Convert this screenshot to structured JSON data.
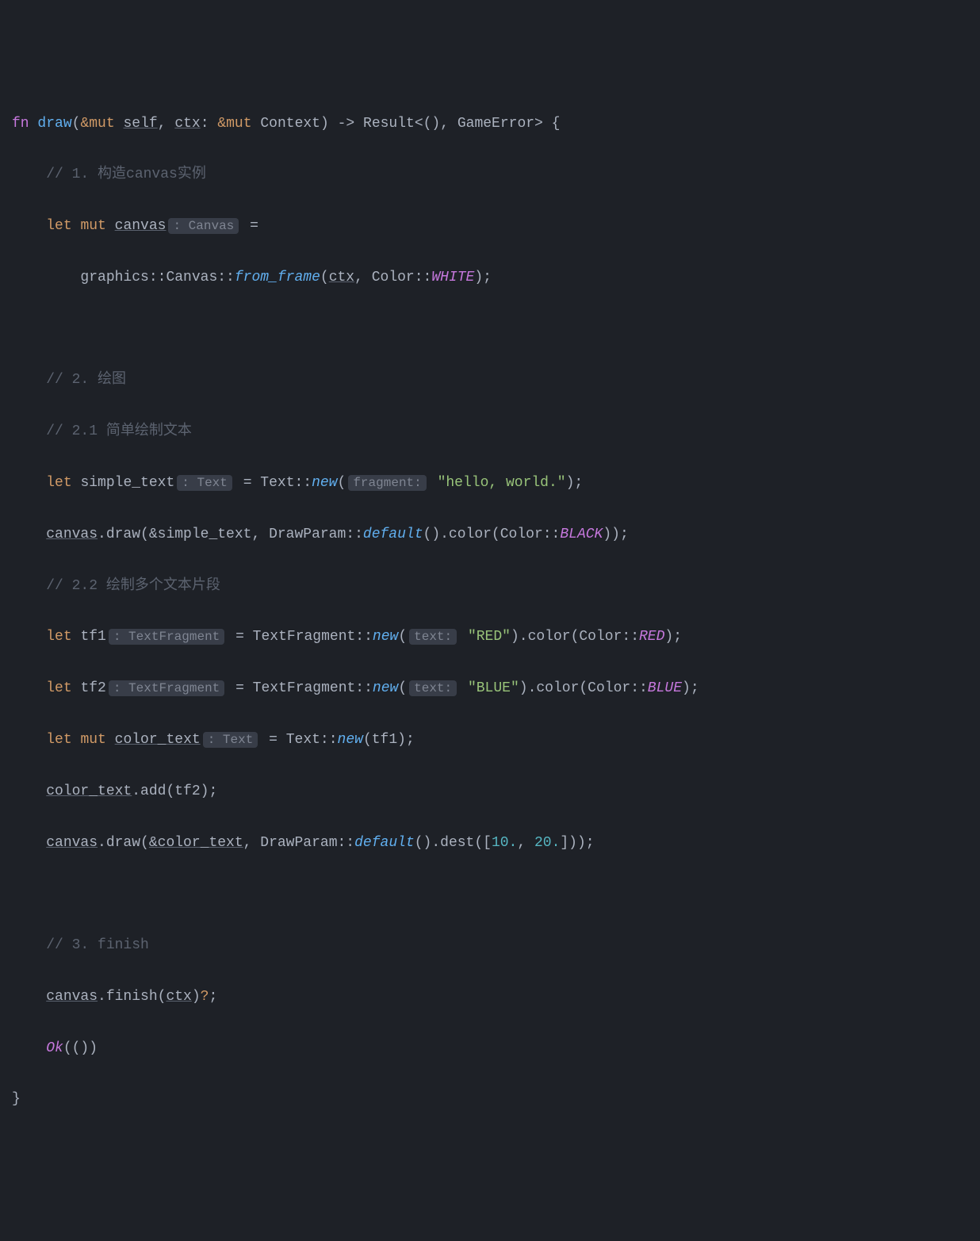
{
  "code": {
    "line1": {
      "fn": "fn",
      "draw": "draw",
      "amp_mut": "&mut",
      "self": "self",
      "ctx": "ctx",
      "context": "Context",
      "arrow": "->",
      "result": "Result<(), GameError> {"
    },
    "line2": {
      "comment": "// 1. 构造canvas实例"
    },
    "line3": {
      "let": "let",
      "mut": "mut",
      "canvas": "canvas",
      "hint": ": Canvas",
      "eq": "="
    },
    "line4": {
      "graphics": "graphics::Canvas::",
      "from_frame": "from_frame",
      "ctx": "ctx",
      "color_white": "Color::",
      "white": "WHITE",
      "close": ");"
    },
    "line6": {
      "comment": "// 2. 绘图"
    },
    "line7": {
      "comment": "// 2.1 简单绘制文本"
    },
    "line8": {
      "let": "let",
      "simple_text": "simple_text",
      "hint": ": Text",
      "eq": "= Text::",
      "new": "new",
      "hint2": "fragment:",
      "str": "\"hello, world.\"",
      "close": ");"
    },
    "line9": {
      "canvas": "canvas",
      "draw": ".draw(&simple_text, DrawParam::",
      "default": "default",
      "color": "().color(Color::",
      "black": "BLACK",
      "close": "));"
    },
    "line10": {
      "comment": "// 2.2 绘制多个文本片段"
    },
    "line11": {
      "let": "let",
      "tf1": "tf1",
      "hint": ": TextFragment",
      "eq": "= TextFragment::",
      "new": "new",
      "hint2": "text:",
      "str": "\"RED\"",
      "color": ").color(Color::",
      "red": "RED",
      "close": ");"
    },
    "line12": {
      "let": "let",
      "tf2": "tf2",
      "hint": ": TextFragment",
      "eq": "= TextFragment::",
      "new": "new",
      "hint2": "text:",
      "str": "\"BLUE\"",
      "color": ").color(Color::",
      "blue": "BLUE",
      "close": ");"
    },
    "line13": {
      "let": "let",
      "mut": "mut",
      "color_text": "color_text",
      "hint": ": Text",
      "eq": "= Text::",
      "new": "new",
      "tf1": "(tf1);"
    },
    "line14": {
      "color_text": "color_text",
      "add": ".add(tf2);"
    },
    "line15": {
      "canvas": "canvas",
      "draw": ".draw(",
      "amp_color": "&color_text",
      "param": ", DrawParam::",
      "default": "default",
      "dest": "().dest([",
      "n1": "10.",
      "comma": ", ",
      "n2": "20.",
      "close": "]));"
    },
    "line17": {
      "comment": "// 3. finish"
    },
    "line18": {
      "canvas": "canvas",
      "finish": ".finish(",
      "ctx": "ctx",
      "close": ")",
      "q": "?",
      "semi": ";"
    },
    "line19": {
      "ok": "Ok",
      "rest": "(())"
    },
    "line20": {
      "brace": "}"
    }
  }
}
